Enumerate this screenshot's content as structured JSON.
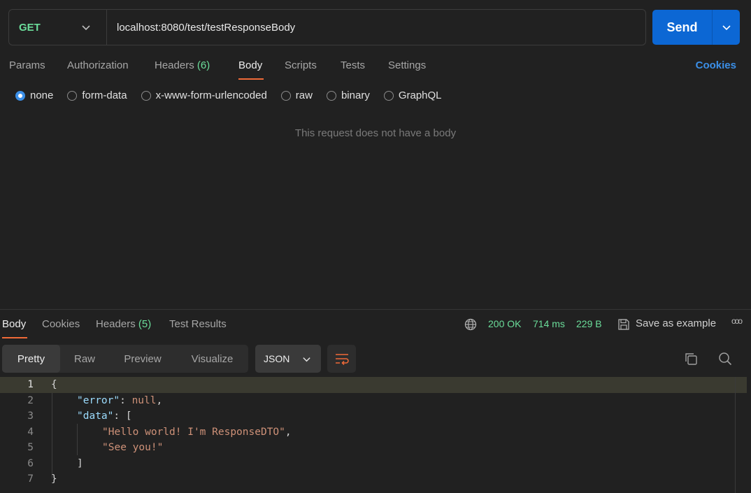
{
  "request": {
    "method": "GET",
    "url": "localhost:8080/test/testResponseBody",
    "send_label": "Send"
  },
  "req_tabs": {
    "params": "Params",
    "authorization": "Authorization",
    "headers": "Headers",
    "headers_count": "(6)",
    "body": "Body",
    "scripts": "Scripts",
    "tests": "Tests",
    "settings": "Settings",
    "cookies": "Cookies"
  },
  "body_options": {
    "none": "none",
    "form_data": "form-data",
    "urlencoded": "x-www-form-urlencoded",
    "raw": "raw",
    "binary": "binary",
    "graphql": "GraphQL",
    "selected": "none"
  },
  "empty_message": "This request does not have a body",
  "response": {
    "tabs": {
      "body": "Body",
      "cookies": "Cookies",
      "headers": "Headers",
      "headers_count": "(5)",
      "test_results": "Test Results"
    },
    "status": "200 OK",
    "time": "714 ms",
    "size": "229 B",
    "save_example": "Save as example",
    "more": "ooo",
    "views": {
      "pretty": "Pretty",
      "raw": "Raw",
      "preview": "Preview",
      "visualize": "Visualize"
    },
    "format": "JSON",
    "line_numbers": [
      "1",
      "2",
      "3",
      "4",
      "5",
      "6",
      "7"
    ],
    "code": {
      "l1": "{",
      "l2_key": "\"error\"",
      "l2_colon": ": ",
      "l2_val": "null",
      "l2_comma": ",",
      "l3_key": "\"data\"",
      "l3_rest": ": [",
      "l4_val": "\"Hello world! I'm ResponseDTO\"",
      "l4_comma": ",",
      "l5_val": "\"See you!\"",
      "l6": "]",
      "l7": "}"
    }
  },
  "colors": {
    "accent_blue": "#0c67d4",
    "tab_underline": "#f06a38",
    "success_green": "#6bdd9a"
  }
}
